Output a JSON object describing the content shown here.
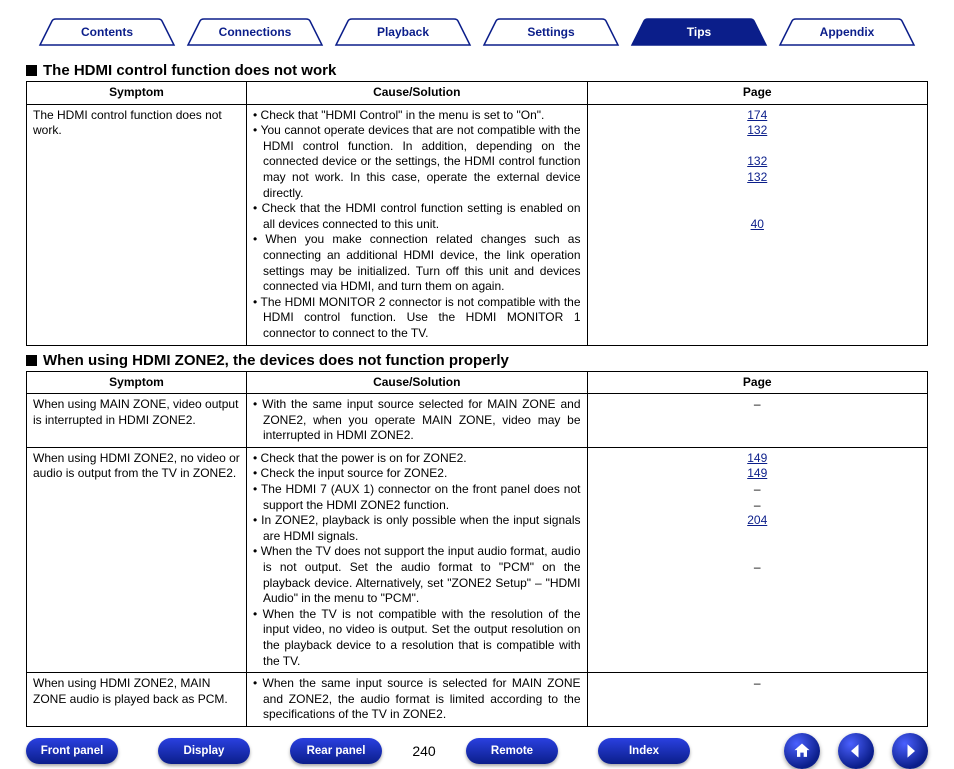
{
  "tabs": {
    "items": [
      {
        "label": "Contents",
        "active": false
      },
      {
        "label": "Connections",
        "active": false
      },
      {
        "label": "Playback",
        "active": false
      },
      {
        "label": "Settings",
        "active": false
      },
      {
        "label": "Tips",
        "active": true
      },
      {
        "label": "Appendix",
        "active": false
      }
    ]
  },
  "sections": [
    {
      "heading": "The HDMI control function does not work",
      "headers": {
        "symptom": "Symptom",
        "cause": "Cause/Solution",
        "page": "Page"
      },
      "rows": [
        {
          "symptom": "The HDMI control function does not work.",
          "causes": [
            "Check that \"HDMI Control\" in the menu is set to \"On\".",
            "You cannot operate devices that are not compatible with the HDMI control function. In addition, depending on the connected device or the settings, the HDMI control function may not work. In this case, operate the external device directly.",
            "Check that the HDMI control function setting is enabled on all devices connected to this unit.",
            "When you make connection related changes such as connecting an additional HDMI device, the link operation settings may be initialized. Turn off this unit and devices connected via HDMI, and turn them on again.",
            "The HDMI MONITOR 2 connector is not compatible with the HDMI control function. Use the HDMI MONITOR 1 connector to connect to the TV."
          ],
          "pages": [
            "174",
            "132",
            "",
            "132",
            "132",
            "",
            "",
            "40"
          ]
        }
      ]
    },
    {
      "heading": "When using HDMI ZONE2, the devices does not function properly",
      "headers": {
        "symptom": "Symptom",
        "cause": "Cause/Solution",
        "page": "Page"
      },
      "rows": [
        {
          "symptom": "When using MAIN ZONE, video output is interrupted in HDMI ZONE2.",
          "causes": [
            "With the same input source selected for MAIN ZONE and ZONE2, when you operate MAIN ZONE, video may be interrupted in HDMI ZONE2."
          ],
          "pages": [
            "–"
          ]
        },
        {
          "symptom": "When using HDMI ZONE2, no video or audio is output from the TV in ZONE2.",
          "causes": [
            "Check that the power is on for ZONE2.",
            "Check the input source for ZONE2.",
            "The HDMI 7 (AUX 1) connector on the front panel does not support the HDMI ZONE2 function.",
            "In ZONE2, playback is only possible when the input signals are HDMI signals.",
            "When the TV does not support the input audio format, audio is not output. Set the audio format to \"PCM\" on the playback device. Alternatively, set \"ZONE2 Setup\" – \"HDMI Audio\" in the menu to \"PCM\".",
            "When the TV is not compatible with the resolution of the input video, no video is output. Set the output resolution on the playback device to a resolution that is compatible with the TV."
          ],
          "pages": [
            "149",
            "149",
            "–",
            "–",
            "204",
            "",
            "",
            "–"
          ]
        },
        {
          "symptom": "When using HDMI ZONE2, MAIN ZONE audio is played back as PCM.",
          "causes": [
            "When the same input source is selected for MAIN ZONE and ZONE2, the audio format is limited according to the specifications of the TV in ZONE2."
          ],
          "pages": [
            "–"
          ]
        }
      ]
    }
  ],
  "footer": {
    "buttons": [
      "Front panel",
      "Display",
      "Rear panel"
    ],
    "page_number": "240",
    "buttons2": [
      "Remote",
      "Index"
    ],
    "icons": [
      "home-icon",
      "arrow-left-icon",
      "arrow-right-icon"
    ]
  }
}
